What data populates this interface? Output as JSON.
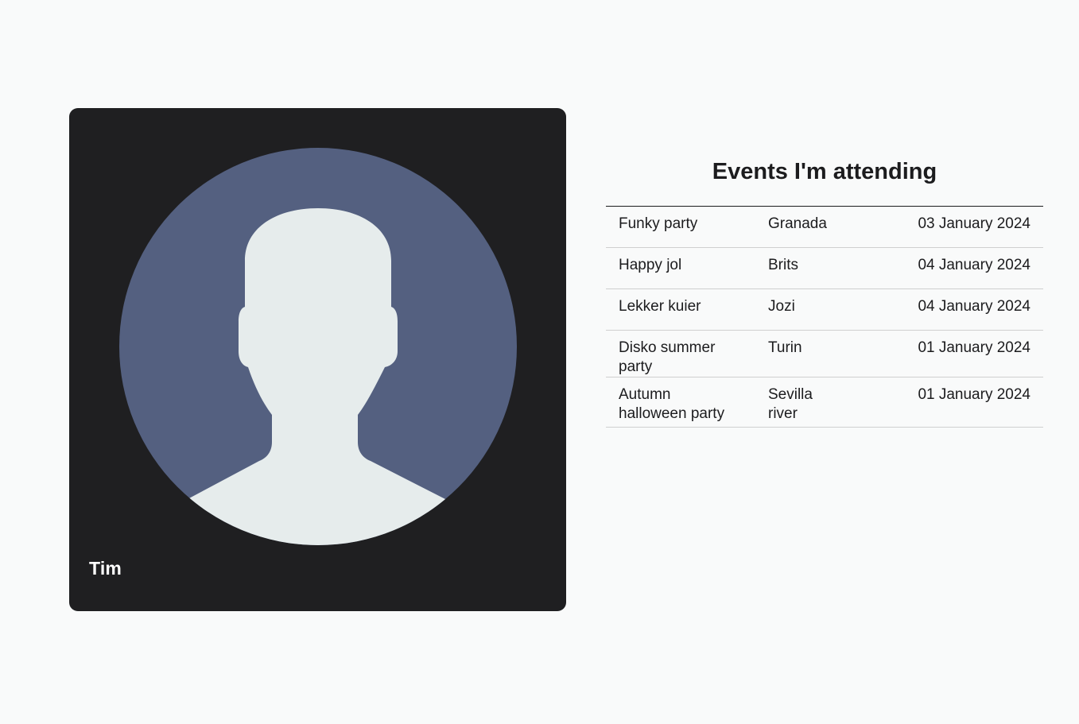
{
  "profile": {
    "name": "Tim",
    "avatar_icon": "default-user-avatar-icon",
    "colors": {
      "card_background": "#1f1f21",
      "avatar_circle": "#546080",
      "avatar_silhouette": "#e6ecec"
    }
  },
  "events": {
    "title": "Events I'm attending",
    "rows": [
      {
        "name": "Funky party",
        "place": "Granada",
        "date": "03 January 2024"
      },
      {
        "name": "Happy jol",
        "place": "Brits",
        "date": "04 January 2024"
      },
      {
        "name": "Lekker kuier",
        "place": "Jozi",
        "date": "04 January 2024"
      },
      {
        "name": "Disko summer party",
        "place": "Turin",
        "date": "01 January 2024"
      },
      {
        "name": "Autumn halloween party",
        "place": "Sevilla river",
        "date": "01 January 2024"
      }
    ]
  }
}
